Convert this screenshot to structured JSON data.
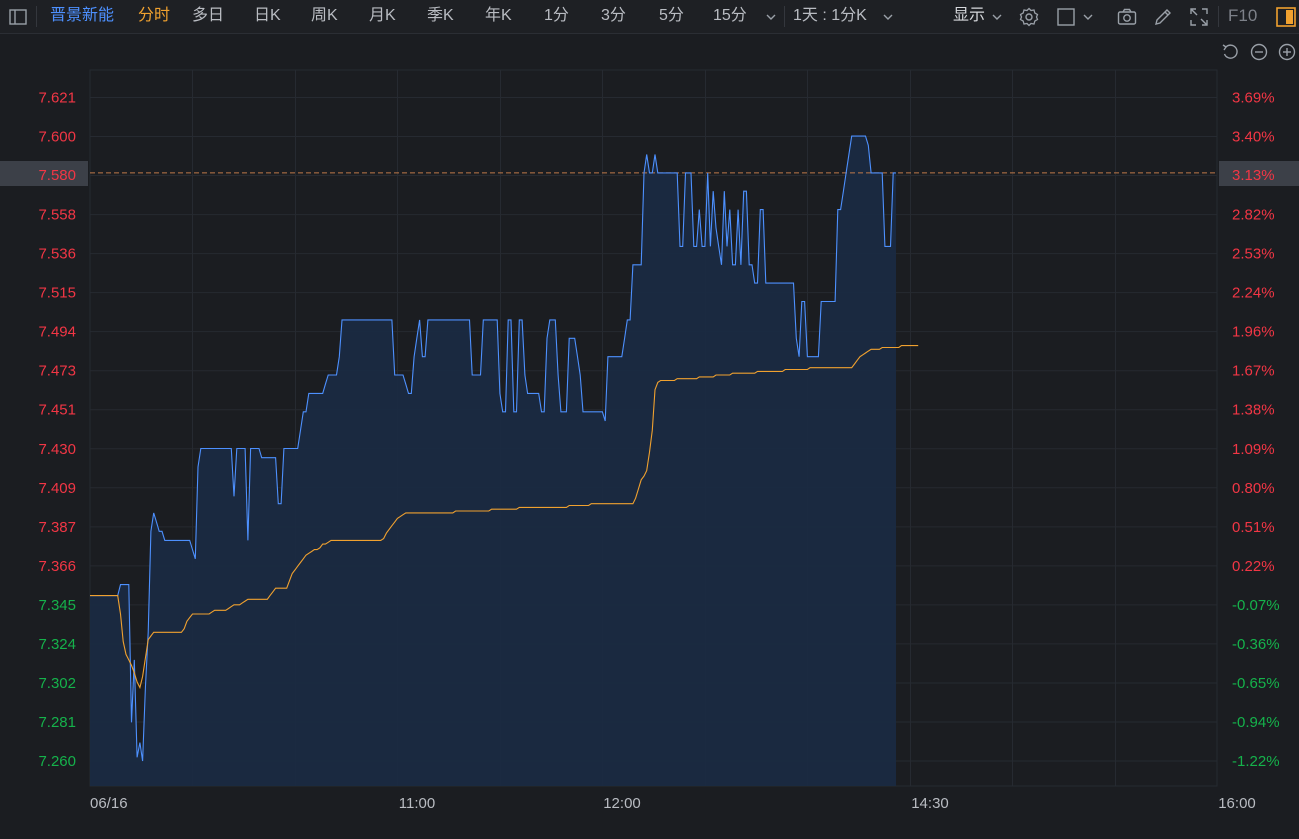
{
  "toolbar": {
    "stock_name": "晋景新能",
    "tabs": [
      "分时",
      "多日",
      "日K",
      "周K",
      "月K",
      "季K",
      "年K",
      "1分",
      "3分",
      "5分",
      "15分"
    ],
    "active_tab": "分时",
    "period_select": "1天 : 1分K",
    "display_label": "显示",
    "f10_label": "F10",
    "icons": [
      "sidebar-toggle-icon",
      "chevron-down-icon",
      "settings-icon",
      "square-icon",
      "camera-icon",
      "pen-icon",
      "fullscreen-icon",
      "panel-icon",
      "undo-icon",
      "zoom-out-icon",
      "zoom-in-icon"
    ]
  },
  "colors": {
    "price_line": "#4d90fe",
    "avg_line": "#f0a12f",
    "up": "#f23645",
    "down": "#15b24b",
    "grid": "#262a31",
    "ref_line": "#c07a4a"
  },
  "chart_data": {
    "type": "line",
    "x_date_label": "06/16",
    "x_ticks": [
      "11:00",
      "12:00",
      "14:30",
      "16:00"
    ],
    "ylim": [
      7.26,
      7.621
    ],
    "y_left_ticks": [
      "7.621",
      "7.600",
      "7.580",
      "7.558",
      "7.536",
      "7.515",
      "7.494",
      "7.473",
      "7.451",
      "7.430",
      "7.409",
      "7.387",
      "7.366",
      "7.345",
      "7.324",
      "7.302",
      "7.281",
      "7.260"
    ],
    "y_right_ticks": [
      "3.69%",
      "3.40%",
      "3.13%",
      "2.82%",
      "2.53%",
      "2.24%",
      "1.96%",
      "1.67%",
      "1.38%",
      "1.09%",
      "0.80%",
      "0.51%",
      "0.22%",
      "-0.07%",
      "-0.36%",
      "-0.65%",
      "-0.94%",
      "-1.22%"
    ],
    "current_price": "7.580",
    "current_change": "3.13%",
    "series": [
      {
        "values": [
          7.35,
          7.35,
          7.35,
          7.35,
          7.35,
          7.35,
          7.35,
          7.35,
          7.35,
          7.35,
          7.35,
          7.356,
          7.356,
          7.356,
          7.356,
          7.281,
          7.315,
          7.262,
          7.27,
          7.26,
          7.3,
          7.33,
          7.385,
          7.395,
          7.39,
          7.385,
          7.385,
          7.38,
          7.38,
          7.38,
          7.38,
          7.38,
          7.38,
          7.38,
          7.38,
          7.38,
          7.38,
          7.375,
          7.37,
          7.42,
          7.43,
          7.43,
          7.43,
          7.43,
          7.43,
          7.43,
          7.43,
          7.43,
          7.43,
          7.43,
          7.43,
          7.43,
          7.404,
          7.43,
          7.43,
          7.43,
          7.43,
          7.38,
          7.43,
          7.43,
          7.43,
          7.43,
          7.425,
          7.425,
          7.425,
          7.425,
          7.425,
          7.425,
          7.4,
          7.4,
          7.43,
          7.43,
          7.43,
          7.43,
          7.43,
          7.43,
          7.44,
          7.45,
          7.45,
          7.46,
          7.46,
          7.46,
          7.46,
          7.46,
          7.46,
          7.465,
          7.47,
          7.47,
          7.47,
          7.47,
          7.48,
          7.5,
          7.5,
          7.5,
          7.5,
          7.5,
          7.5,
          7.5,
          7.5,
          7.5,
          7.5,
          7.5,
          7.5,
          7.5,
          7.5,
          7.5,
          7.5,
          7.5,
          7.5,
          7.5,
          7.47,
          7.47,
          7.47,
          7.47,
          7.465,
          7.46,
          7.46,
          7.48,
          7.49,
          7.5,
          7.48,
          7.48,
          7.5,
          7.5,
          7.5,
          7.5,
          7.5,
          7.5,
          7.5,
          7.5,
          7.5,
          7.5,
          7.5,
          7.5,
          7.5,
          7.5,
          7.5,
          7.5,
          7.47,
          7.47,
          7.47,
          7.47,
          7.5,
          7.5,
          7.5,
          7.5,
          7.5,
          7.5,
          7.46,
          7.45,
          7.45,
          7.5,
          7.5,
          7.45,
          7.45,
          7.5,
          7.5,
          7.47,
          7.46,
          7.46,
          7.46,
          7.46,
          7.46,
          7.45,
          7.45,
          7.49,
          7.5,
          7.5,
          7.5,
          7.47,
          7.45,
          7.45,
          7.45,
          7.49,
          7.49,
          7.49,
          7.48,
          7.47,
          7.45,
          7.45,
          7.45,
          7.45,
          7.45,
          7.45,
          7.45,
          7.45,
          7.445,
          7.48,
          7.48,
          7.48,
          7.48,
          7.48,
          7.48,
          7.49,
          7.5,
          7.5,
          7.53,
          7.53,
          7.53,
          7.53,
          7.58,
          7.59,
          7.58,
          7.58,
          7.59,
          7.58,
          7.58,
          7.58,
          7.58,
          7.58,
          7.58,
          7.58,
          7.58,
          7.54,
          7.54,
          7.58,
          7.58,
          7.58,
          7.54,
          7.54,
          7.56,
          7.54,
          7.54,
          7.58,
          7.54,
          7.57,
          7.55,
          7.54,
          7.53,
          7.57,
          7.54,
          7.56,
          7.53,
          7.53,
          7.56,
          7.53,
          7.57,
          7.57,
          7.53,
          7.53,
          7.52,
          7.52,
          7.56,
          7.56,
          7.52,
          7.52,
          7.52,
          7.52,
          7.52,
          7.52,
          7.52,
          7.52,
          7.52,
          7.52,
          7.52,
          7.49,
          7.48,
          7.51,
          7.51,
          7.48,
          7.48,
          7.48,
          7.48,
          7.48,
          7.51,
          7.51,
          7.51,
          7.51,
          7.51,
          7.51,
          7.56,
          7.56,
          7.57,
          7.58,
          7.59,
          7.6,
          7.6,
          7.6,
          7.6,
          7.6,
          7.6,
          7.595,
          7.58,
          7.58,
          7.58,
          7.58,
          7.58,
          7.54,
          7.54,
          7.54,
          7.58,
          7.58
        ]
      },
      {
        "values": [
          7.35,
          7.35,
          7.35,
          7.35,
          7.35,
          7.35,
          7.35,
          7.35,
          7.35,
          7.35,
          7.35,
          7.34,
          7.325,
          7.318,
          7.315,
          7.312,
          7.308,
          7.303,
          7.3,
          7.306,
          7.316,
          7.326,
          7.328,
          7.33,
          7.33,
          7.33,
          7.33,
          7.33,
          7.33,
          7.33,
          7.33,
          7.33,
          7.33,
          7.33,
          7.332,
          7.336,
          7.338,
          7.34,
          7.34,
          7.34,
          7.34,
          7.34,
          7.34,
          7.34,
          7.341,
          7.342,
          7.342,
          7.342,
          7.342,
          7.342,
          7.343,
          7.344,
          7.345,
          7.345,
          7.345,
          7.346,
          7.347,
          7.348,
          7.348,
          7.348,
          7.348,
          7.348,
          7.348,
          7.348,
          7.348,
          7.35,
          7.352,
          7.354,
          7.354,
          7.354,
          7.354,
          7.354,
          7.358,
          7.362,
          7.364,
          7.366,
          7.368,
          7.37,
          7.372,
          7.373,
          7.374,
          7.375,
          7.375,
          7.376,
          7.378,
          7.378,
          7.379,
          7.38,
          7.38,
          7.38,
          7.38,
          7.38,
          7.38,
          7.38,
          7.38,
          7.38,
          7.38,
          7.38,
          7.38,
          7.38,
          7.38,
          7.38,
          7.38,
          7.38,
          7.38,
          7.38,
          7.381,
          7.384,
          7.386,
          7.388,
          7.39,
          7.392,
          7.393,
          7.394,
          7.395,
          7.395,
          7.395,
          7.395,
          7.395,
          7.395,
          7.395,
          7.395,
          7.395,
          7.395,
          7.395,
          7.395,
          7.395,
          7.395,
          7.395,
          7.395,
          7.395,
          7.395,
          7.396,
          7.396,
          7.396,
          7.396,
          7.396,
          7.396,
          7.396,
          7.396,
          7.396,
          7.396,
          7.396,
          7.396,
          7.396,
          7.397,
          7.397,
          7.397,
          7.397,
          7.397,
          7.397,
          7.397,
          7.397,
          7.397,
          7.397,
          7.398,
          7.398,
          7.398,
          7.398,
          7.398,
          7.398,
          7.398,
          7.398,
          7.398,
          7.398,
          7.398,
          7.398,
          7.398,
          7.398,
          7.398,
          7.398,
          7.398,
          7.398,
          7.399,
          7.399,
          7.399,
          7.399,
          7.399,
          7.399,
          7.399,
          7.399,
          7.4,
          7.4,
          7.4,
          7.4,
          7.4,
          7.4,
          7.4,
          7.4,
          7.4,
          7.4,
          7.4,
          7.4,
          7.4,
          7.4,
          7.4,
          7.4,
          7.403,
          7.408,
          7.413,
          7.415,
          7.418,
          7.428,
          7.44,
          7.462,
          7.466,
          7.467,
          7.467,
          7.467,
          7.467,
          7.467,
          7.467,
          7.468,
          7.468,
          7.468,
          7.468,
          7.468,
          7.468,
          7.468,
          7.468,
          7.469,
          7.469,
          7.469,
          7.469,
          7.469,
          7.469,
          7.47,
          7.47,
          7.47,
          7.47,
          7.47,
          7.47,
          7.471,
          7.471,
          7.471,
          7.471,
          7.471,
          7.471,
          7.471,
          7.471,
          7.471,
          7.472,
          7.472,
          7.472,
          7.472,
          7.472,
          7.472,
          7.472,
          7.472,
          7.472,
          7.472,
          7.473,
          7.473,
          7.473,
          7.473,
          7.473,
          7.473,
          7.473,
          7.473,
          7.473,
          7.474,
          7.474,
          7.474,
          7.474,
          7.474,
          7.474,
          7.474,
          7.474,
          7.474,
          7.474,
          7.474,
          7.474,
          7.474,
          7.474,
          7.474,
          7.474,
          7.476,
          7.478,
          7.48,
          7.481,
          7.482,
          7.483,
          7.484,
          7.484,
          7.484,
          7.484,
          7.485,
          7.485,
          7.485,
          7.485,
          7.485,
          7.485,
          7.485,
          7.486,
          7.486,
          7.486,
          7.486,
          7.486,
          7.486,
          7.486
        ]
      }
    ]
  }
}
